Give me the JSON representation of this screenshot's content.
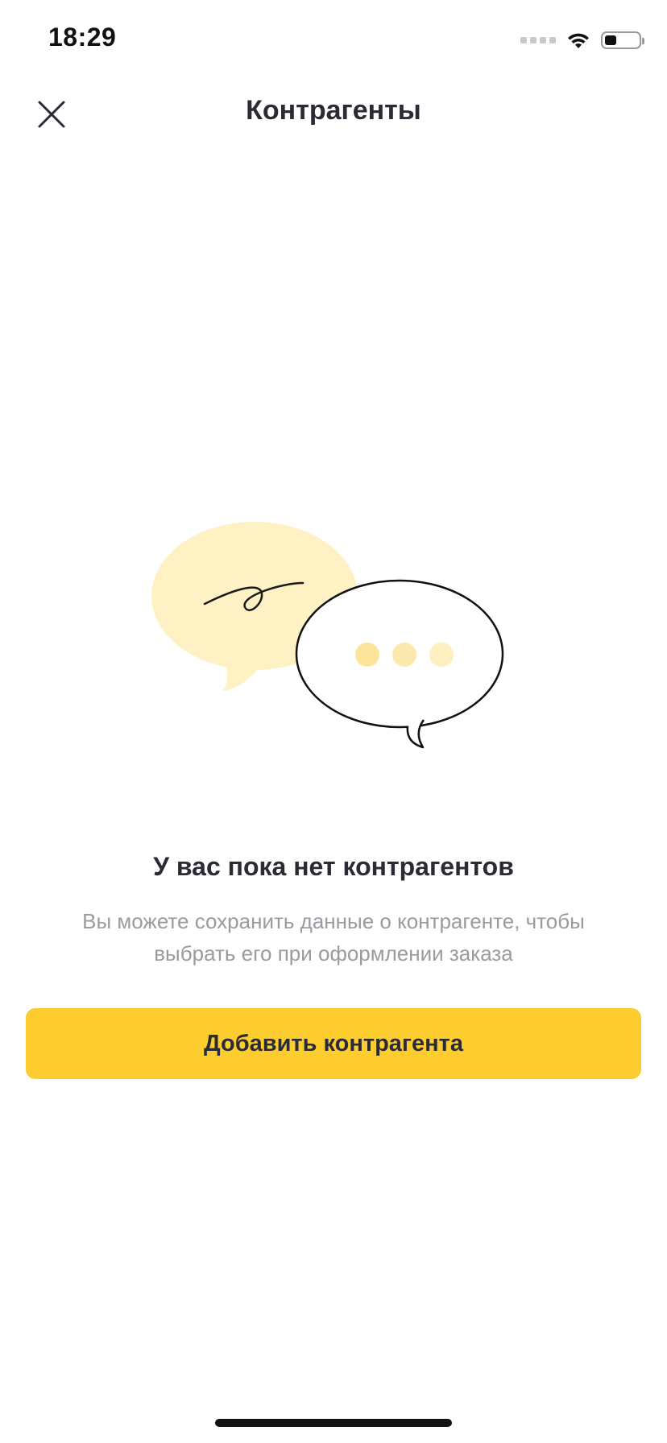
{
  "status_bar": {
    "time": "18:29"
  },
  "nav": {
    "title": "Контрагенты",
    "close_icon": "close-icon"
  },
  "empty_state": {
    "illustration": "chat-bubbles-icon",
    "title": "У вас пока нет контрагентов",
    "description": "Вы можете сохранить данные о контрагенте, чтобы выбрать его при оформлении заказа"
  },
  "actions": {
    "add_label": "Добавить контрагента"
  },
  "colors": {
    "accent": "#fdcc2f",
    "bubble_fill": "#fef1c3",
    "dot_fill": "#fce7a6",
    "text_primary": "#2b2b36",
    "text_secondary": "#9a9aa0"
  }
}
